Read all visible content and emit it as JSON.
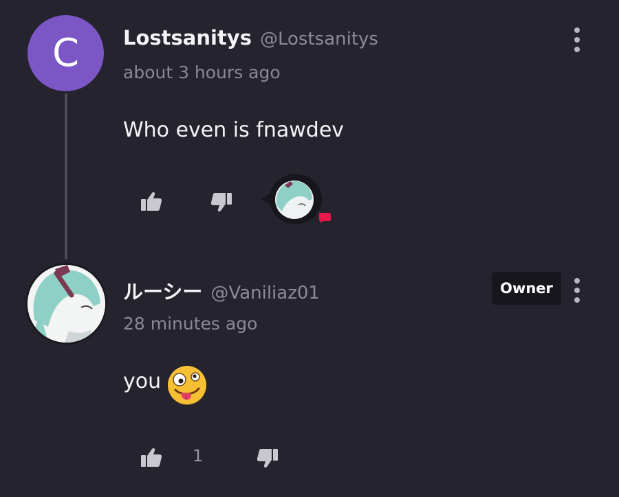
{
  "comments": [
    {
      "avatar_letter": "C",
      "username": "Lostsanitys",
      "handle": "@Lostsanitys",
      "time": "about 3 hours ago",
      "text": "Who even is fnawdev"
    },
    {
      "username": "ルーシー",
      "handle": "@Vaniliaz01",
      "badge": "Owner",
      "time": "28 minutes ago",
      "text": "you",
      "emoji": "🤪",
      "likes": "1"
    }
  ],
  "colors": {
    "background": "#25232d",
    "avatar_purple": "#7b56c4",
    "reply_indicator": "#e8194a"
  },
  "icons": [
    "thumbs-up-icon",
    "thumbs-down-icon",
    "more-vertical-icon",
    "reply-avatar-icon"
  ]
}
